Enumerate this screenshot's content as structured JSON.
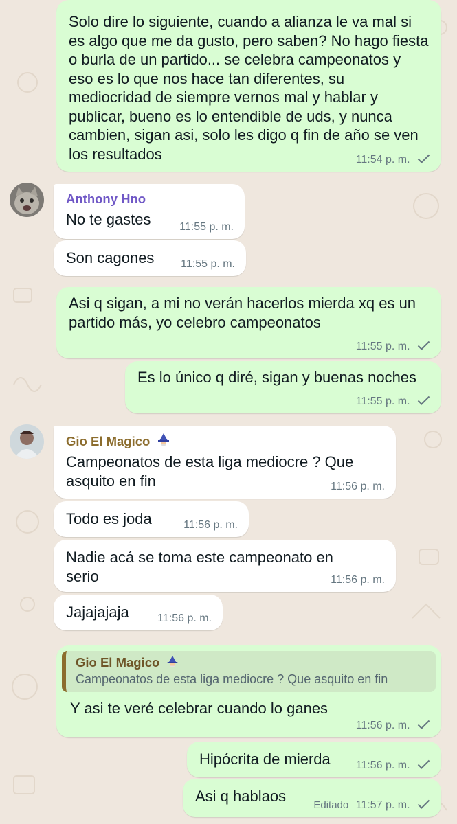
{
  "colors": {
    "background": "#efe7de",
    "outgoing_bubble": "#d9fdd3",
    "incoming_bubble": "#ffffff",
    "sender_anthony": "#6f57c6",
    "sender_gio": "#8c6d2e",
    "meta_text": "#667781"
  },
  "messages": [
    {
      "text": "Solo dire lo siguiente, cuando a alianza le va mal si es algo que me da gusto, pero saben? No hago fiesta o burla de un partido... se celebra campeonatos y eso es lo que nos hace tan diferentes, su mediocridad de siempre vernos mal y hablar y publicar, bueno es lo entendible de uds, y nunca cambien, sigan asi, solo les digo q fin de año se ven los resultados",
      "time": "11:54 p. m."
    },
    {
      "sender": "Anthony Hno",
      "text": "No te gastes",
      "time": "11:55 p. m."
    },
    {
      "text": "Son cagones",
      "time": "11:55 p. m."
    },
    {
      "text": "Asi q sigan, a mi no verán hacerlos mierda xq es un partido más, yo celebro campeonatos",
      "time": "11:55 p. m."
    },
    {
      "text": "Es lo único q diré, sigan y buenas noches",
      "time": "11:55 p. m."
    },
    {
      "sender": "Gio El Magico",
      "text": "Campeonatos de esta liga mediocre ? Que asquito en fin",
      "time": "11:56 p. m."
    },
    {
      "text": "Todo es joda",
      "time": "11:56 p. m."
    },
    {
      "text": "Nadie acá se toma este campeonato en serio",
      "time": "11:56 p. m."
    },
    {
      "text": "Jajajajaja",
      "time": "11:56 p. m."
    },
    {
      "quote_name": "Gio El Magico",
      "quote_text": "Campeonatos de esta liga mediocre ? Que asquito en fin",
      "text": "Y asi te veré celebrar cuando lo ganes",
      "time": "11:56 p. m."
    },
    {
      "text": "Hipócrita de mierda",
      "time": "11:56 p. m."
    },
    {
      "text": "Asi q hablaos",
      "edited": "Editado",
      "time": "11:57 p. m."
    }
  ]
}
